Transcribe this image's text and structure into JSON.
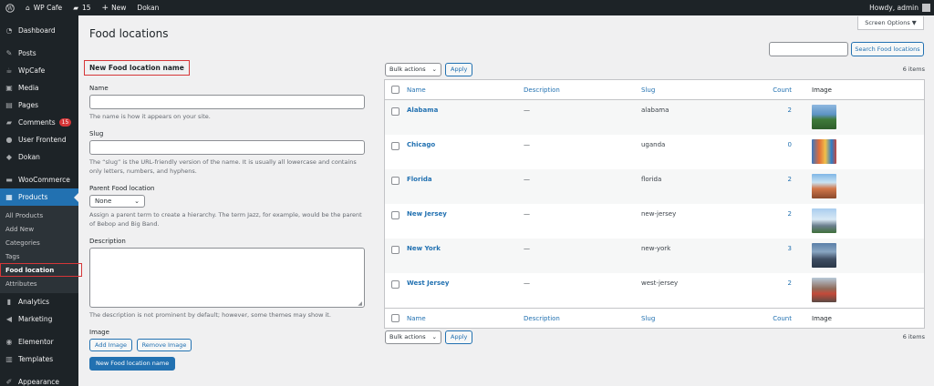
{
  "adminbar": {
    "site_name": "WP Cafe",
    "comments_count": "15",
    "new_label": "New",
    "dokan_label": "Dokan",
    "howdy": "Howdy, admin"
  },
  "sidebar": {
    "items": [
      {
        "label": "Dashboard",
        "icon": "dashboard-icon"
      },
      {
        "label": "Posts",
        "icon": "pin-icon"
      },
      {
        "label": "WpCafe",
        "icon": "cafe-icon"
      },
      {
        "label": "Media",
        "icon": "media-icon"
      },
      {
        "label": "Pages",
        "icon": "pages-icon"
      },
      {
        "label": "Comments",
        "icon": "comment-icon",
        "badge": "15"
      },
      {
        "label": "User Frontend",
        "icon": "user-frontend-icon"
      },
      {
        "label": "Dokan",
        "icon": "dokan-icon"
      },
      {
        "label": "WooCommerce",
        "icon": "woocommerce-icon"
      },
      {
        "label": "Products",
        "icon": "products-icon"
      },
      {
        "label": "Analytics",
        "icon": "analytics-icon"
      },
      {
        "label": "Marketing",
        "icon": "marketing-icon"
      },
      {
        "label": "Elementor",
        "icon": "elementor-icon"
      },
      {
        "label": "Templates",
        "icon": "templates-icon"
      },
      {
        "label": "Appearance",
        "icon": "appearance-icon"
      }
    ],
    "submenu": [
      "All Products",
      "Add New",
      "Categories",
      "Tags",
      "Food location",
      "Attributes"
    ]
  },
  "screen_options": "Screen Options ▼",
  "page_title": "Food locations",
  "form": {
    "heading": "New Food location name",
    "name_label": "Name",
    "name_help": "The name is how it appears on your site.",
    "slug_label": "Slug",
    "slug_help": "The “slug” is the URL-friendly version of the name. It is usually all lowercase and contains only letters, numbers, and hyphens.",
    "parent_label": "Parent Food location",
    "parent_value": "None",
    "parent_help": "Assign a parent term to create a hierarchy. The term Jazz, for example, would be the parent of Bebop and Big Band.",
    "description_label": "Description",
    "description_help": "The description is not prominent by default; however, some themes may show it.",
    "image_label": "Image",
    "add_image": "Add Image",
    "remove_image": "Remove Image",
    "submit": "New Food location name"
  },
  "search": {
    "button": "Search Food locations"
  },
  "tablenav": {
    "bulk_actions": "Bulk actions",
    "apply": "Apply",
    "items_count": "6 items"
  },
  "table": {
    "columns": {
      "name": "Name",
      "description": "Description",
      "slug": "Slug",
      "count": "Count",
      "image": "Image"
    },
    "rows": [
      {
        "name": "Alabama",
        "description": "—",
        "slug": "alabama",
        "count": "2"
      },
      {
        "name": "Chicago",
        "description": "—",
        "slug": "uganda",
        "count": "0"
      },
      {
        "name": "Florida",
        "description": "—",
        "slug": "florida",
        "count": "2"
      },
      {
        "name": "New Jersey",
        "description": "—",
        "slug": "new-jersey",
        "count": "2"
      },
      {
        "name": "New York",
        "description": "—",
        "slug": "new-york",
        "count": "3"
      },
      {
        "name": "West Jersey",
        "description": "—",
        "slug": "west-jersey",
        "count": "2"
      }
    ]
  },
  "colors": {
    "accent": "#2271b1",
    "sidebar": "#1d2327",
    "highlight": "#d63638"
  }
}
